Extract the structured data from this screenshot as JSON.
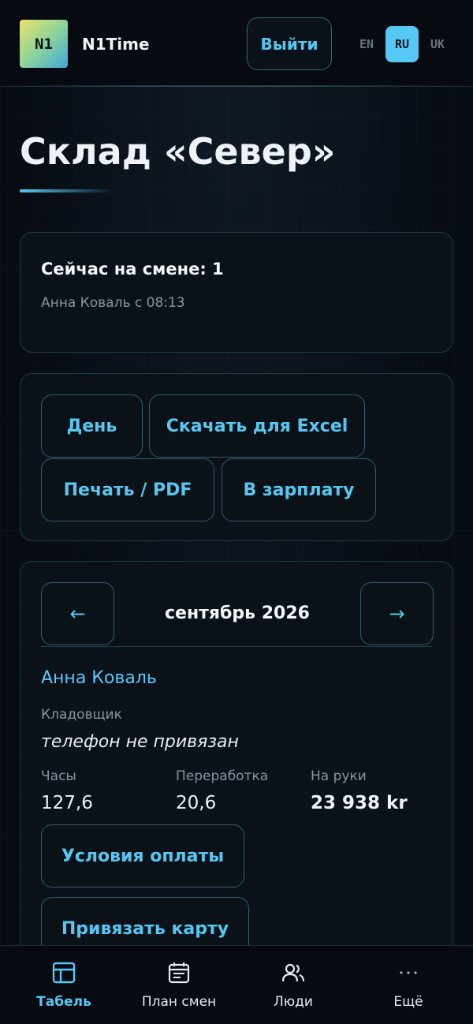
{
  "header": {
    "logo_text": "N1",
    "app_name": "N1Time",
    "logout_label": "Выйти",
    "languages": [
      "EN",
      "RU",
      "UK"
    ],
    "active_language": "RU"
  },
  "page": {
    "title": "Склад «Север»"
  },
  "shift": {
    "title": "Сейчас на смене: 1",
    "person": "Анна Коваль с 08:13"
  },
  "actions": {
    "day": "День",
    "excel": "Скачать для Excel",
    "print": "Печать / PDF",
    "payroll": "В зарплату"
  },
  "month": {
    "prev": "←",
    "next": "→",
    "label": "сентябрь 2026"
  },
  "employee": {
    "name": "Анна Коваль",
    "role": "Кладовщик",
    "phone": "телефон не привязан",
    "hours_label": "Часы",
    "hours_value": "127,6",
    "overtime_label": "Переработка",
    "overtime_value": "20,6",
    "net_label": "На руки",
    "net_value": "23 938 kr",
    "pay_terms_button": "Условия оплаты",
    "link_card_button": "Привязать карту"
  },
  "bottom_nav": {
    "items": [
      {
        "label": "Табель",
        "icon": "table-icon"
      },
      {
        "label": "План смен",
        "icon": "calendar-icon"
      },
      {
        "label": "Люди",
        "icon": "people-icon"
      },
      {
        "label": "Ещё",
        "icon": "more-icon"
      }
    ],
    "active_index": 0
  },
  "colors": {
    "accent": "#56c8f5",
    "background": "#070b12",
    "card": "#0a1119"
  }
}
